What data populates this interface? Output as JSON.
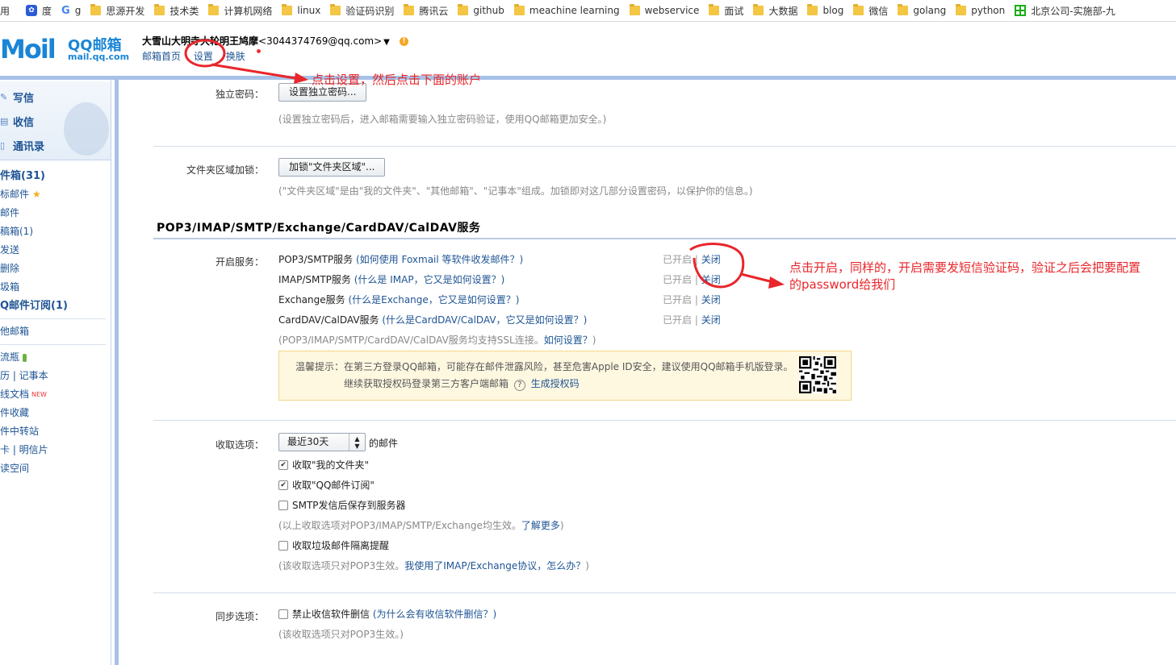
{
  "bookmarks": [
    {
      "label": "用",
      "icon": "none"
    },
    {
      "label": "度",
      "icon": "baidu-paw"
    },
    {
      "label": "g",
      "icon": "google"
    },
    {
      "label": "思源开发",
      "icon": "folder"
    },
    {
      "label": "技术类",
      "icon": "folder"
    },
    {
      "label": "计算机网络",
      "icon": "folder"
    },
    {
      "label": "linux",
      "icon": "folder"
    },
    {
      "label": "验证码识别",
      "icon": "folder"
    },
    {
      "label": "腾讯云",
      "icon": "folder"
    },
    {
      "label": "github",
      "icon": "folder"
    },
    {
      "label": "meachine learning",
      "icon": "folder"
    },
    {
      "label": "webservice",
      "icon": "folder"
    },
    {
      "label": "面试",
      "icon": "folder"
    },
    {
      "label": "大数据",
      "icon": "folder"
    },
    {
      "label": "blog",
      "icon": "folder"
    },
    {
      "label": "微信",
      "icon": "folder"
    },
    {
      "label": "golang",
      "icon": "folder"
    },
    {
      "label": "python",
      "icon": "folder"
    },
    {
      "label": "北京公司-实施部-九",
      "icon": "green-grid"
    }
  ],
  "header": {
    "logo_mark": "Moil",
    "logo_text": "QQ邮箱",
    "logo_domain": "mail.qq.com",
    "user_name": "大雪山大明寺大轮明王鸠摩",
    "user_email": "<3044374769@qq.com>",
    "user_arrow": "▼",
    "notice_icon": "!",
    "nav": [
      "邮箱首页",
      "设置",
      "换肤"
    ]
  },
  "sidebar": {
    "actions": [
      "写信",
      "收信",
      "通讯录"
    ],
    "items": [
      {
        "label": "件箱(31)",
        "bold": true
      },
      {
        "label": "标邮件",
        "bold": false,
        "star": true
      },
      {
        "label": "邮件",
        "bold": false
      },
      {
        "label": "稿箱(1)",
        "bold": false
      },
      {
        "label": "发送",
        "bold": false
      },
      {
        "label": "删除",
        "bold": false
      },
      {
        "label": "圾箱",
        "bold": false
      },
      {
        "label": "Q邮件订阅(1)",
        "bold": true
      }
    ],
    "other": "他邮箱",
    "tools": [
      {
        "label": "流瓶",
        "bottle": true
      },
      {
        "label": "历 | 记事本"
      },
      {
        "label": "线文档",
        "badge": "NEW"
      },
      {
        "label": "件收藏"
      },
      {
        "label": "件中转站"
      },
      {
        "label": "卡 | 明信片"
      },
      {
        "label": "读空间"
      }
    ]
  },
  "main": {
    "password": {
      "label": "独立密码：",
      "button": "设置独立密码...",
      "hint": "(设置独立密码后，进入邮箱需要输入独立密码验证，使用QQ邮箱更加安全。)"
    },
    "folder_lock": {
      "label": "文件夹区域加锁：",
      "button": "加锁\"文件夹区域\"...",
      "hint": "(\"文件夹区域\"是由\"我的文件夹\"、\"其他邮箱\"、\"记事本\"组成。加锁即对这几部分设置密码，以保护你的信息。)"
    },
    "section_title": "POP3/IMAP/SMTP/Exchange/CardDAV/CalDAV服务",
    "services_label": "开启服务：",
    "services": [
      {
        "name": "POP3/SMTP服务",
        "help": "(如何使用 Foxmail 等软件收发邮件？)",
        "status": "已开启",
        "sep": "|",
        "action": "关闭"
      },
      {
        "name": "IMAP/SMTP服务",
        "help": "(什么是 IMAP，它又是如何设置？)",
        "status": "已开启",
        "sep": "|",
        "action": "关闭"
      },
      {
        "name": "Exchange服务",
        "help": "(什么是Exchange，它又是如何设置？)",
        "status": "已开启",
        "sep": "|",
        "action": "关闭"
      },
      {
        "name": "CardDAV/CalDAV服务",
        "help": "(什么是CardDAV/CalDAV，它又是如何设置？)",
        "status": "已开启",
        "sep": "|",
        "action": "关闭"
      }
    ],
    "ssl_hint": "(POP3/IMAP/SMTP/CardDAV/CalDAV服务均支持SSL连接。",
    "ssl_link": "如何设置？",
    "ssl_end": ")",
    "tip_line1": "温馨提示：在第三方登录QQ邮箱，可能存在邮件泄露风险，甚至危害Apple ID安全，建议使用QQ邮箱手机版登录。",
    "tip_line2": "继续获取授权码登录第三方客户端邮箱",
    "tip_help": "?",
    "tip_link": "生成授权码",
    "receive_label": "收取选项：",
    "receive_select": "最近30天",
    "receive_suffix": "的邮件",
    "receive_checks": [
      {
        "label": "收取\"我的文件夹\"",
        "checked": true
      },
      {
        "label": "收取\"QQ邮件订阅\"",
        "checked": true
      },
      {
        "label": "SMTP发信后保存到服务器",
        "checked": false
      }
    ],
    "receive_hint": "(以上收取选项对POP3/IMAP/SMTP/Exchange均生效。",
    "receive_hint_link": "了解更多",
    "receive_hint_end": ")",
    "spam_check": {
      "label": "收取垃圾邮件隔离提醒",
      "checked": false
    },
    "spam_hint": "(该收取选项只对POP3生效。",
    "spam_hint_link": "我使用了IMAP/Exchange协议，怎么办？",
    "spam_hint_end": ")",
    "sync_label": "同步选项：",
    "sync_check": {
      "label": "禁止收信软件删信",
      "checked": false
    },
    "sync_help": "(为什么会有收信软件删信？)",
    "sync_hint": "(该收取选项只对POP3生效。)"
  },
  "annotations": {
    "note1": "点击设置，然后点击下面的账户",
    "note2_line1": "点击开启，同样的，开启需要发短信验证码，验证之后会把要配置",
    "note2_line2": "的password给我们",
    "color": "#e8262b"
  }
}
